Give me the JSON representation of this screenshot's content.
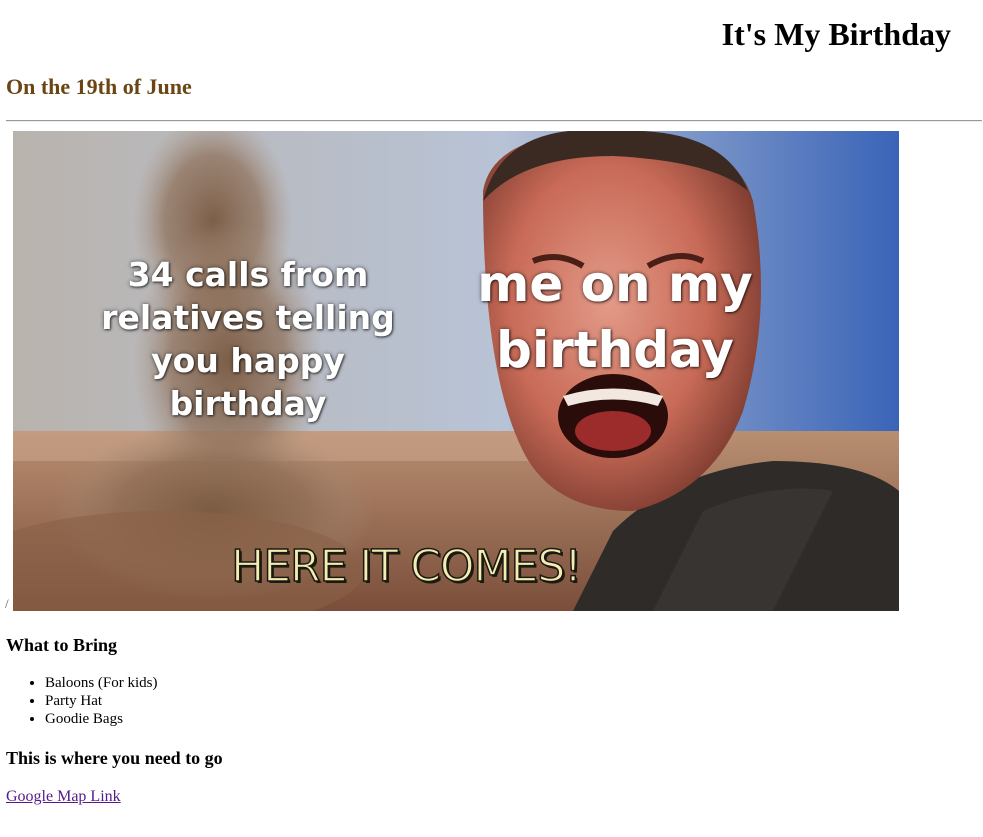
{
  "header": {
    "title": "It's My Birthday",
    "date_heading": "On the 19th of June",
    "date_heading_color": "#6b4513"
  },
  "meme": {
    "separator_glyph": "/",
    "caption_left": "34 calls from relatives telling you happy birthday",
    "caption_right": "me on my birthday",
    "caption_bottom": "HERE IT COMES!"
  },
  "bring": {
    "heading": "What to Bring",
    "items": [
      "Baloons (For kids)",
      "Party Hat",
      "Goodie Bags"
    ]
  },
  "directions": {
    "heading": "This is where you need to go",
    "link_label": "Google Map Link",
    "link_color": "#551a8b"
  }
}
